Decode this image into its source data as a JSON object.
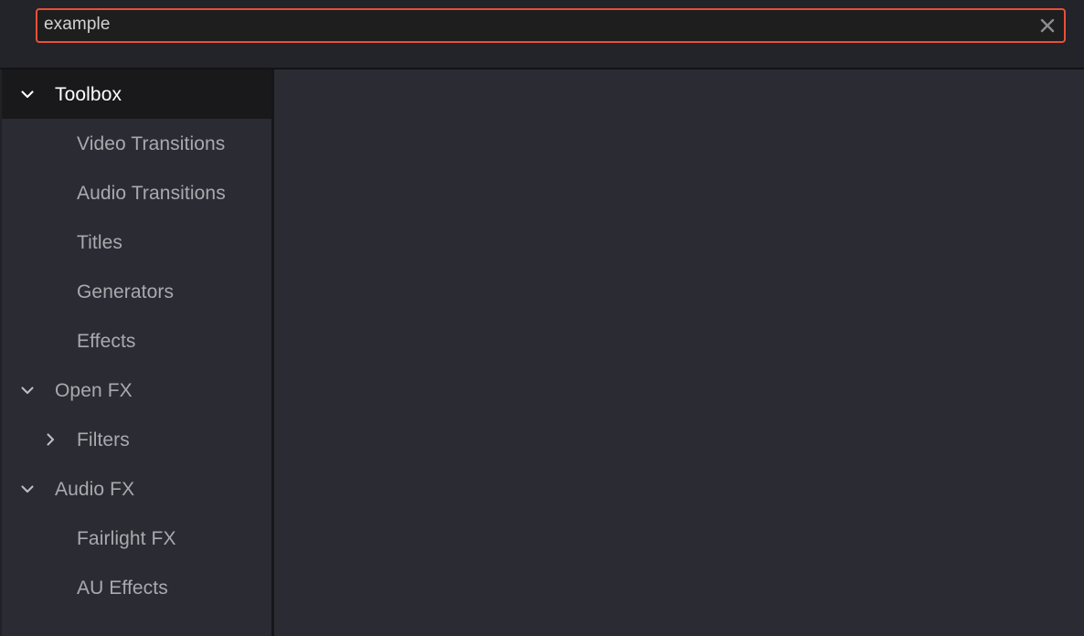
{
  "search": {
    "value": "example",
    "placeholder": "Search",
    "clear_icon": "close-icon",
    "border_color": "#e8503a",
    "field_background": "#1e1e1e",
    "text_color": "#d2d2d2"
  },
  "sidebar": {
    "background": "#2b2b33",
    "selected_background": "#19191c",
    "label_color": "#a9a9ae",
    "selected_label_color": "#ffffff",
    "items": [
      {
        "label": "Toolbox",
        "depth": 0,
        "twisty": "chevron-down-icon",
        "selected": true,
        "name": "toolbox"
      },
      {
        "label": "Video Transitions",
        "depth": 1,
        "twisty": "none",
        "selected": false,
        "name": "video-transitions"
      },
      {
        "label": "Audio Transitions",
        "depth": 1,
        "twisty": "none",
        "selected": false,
        "name": "audio-transitions"
      },
      {
        "label": "Titles",
        "depth": 1,
        "twisty": "none",
        "selected": false,
        "name": "titles"
      },
      {
        "label": "Generators",
        "depth": 1,
        "twisty": "none",
        "selected": false,
        "name": "generators"
      },
      {
        "label": "Effects",
        "depth": 1,
        "twisty": "none",
        "selected": false,
        "name": "effects"
      },
      {
        "label": "Open FX",
        "depth": 0,
        "twisty": "chevron-down-icon",
        "selected": false,
        "name": "open-fx"
      },
      {
        "label": "Filters",
        "depth": 1,
        "twisty": "chevron-right-icon",
        "selected": false,
        "name": "filters"
      },
      {
        "label": "Audio FX",
        "depth": 0,
        "twisty": "chevron-down-icon",
        "selected": false,
        "name": "audio-fx"
      },
      {
        "label": "Fairlight FX",
        "depth": 1,
        "twisty": "none",
        "selected": false,
        "name": "fairlight-fx"
      },
      {
        "label": "AU Effects",
        "depth": 1,
        "twisty": "none",
        "selected": false,
        "name": "au-effects"
      }
    ]
  },
  "content": {
    "background": "#2b2b33",
    "items": []
  }
}
